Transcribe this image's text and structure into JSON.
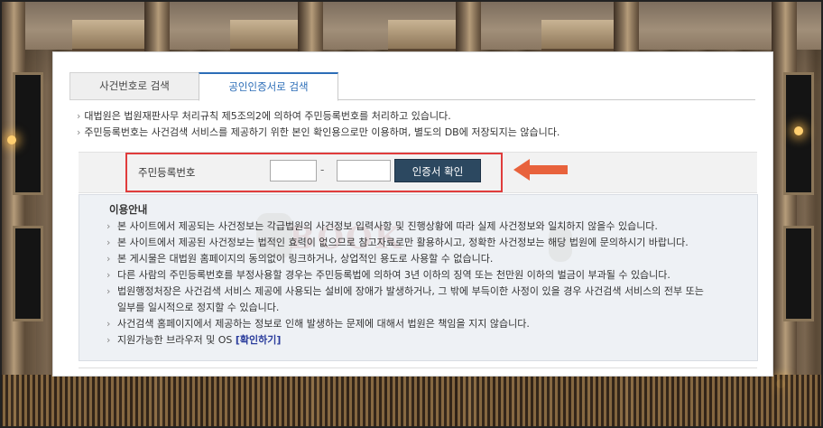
{
  "tabs": {
    "case_search": "사건번호로 검색",
    "cert_search": "공인인증서로 검색"
  },
  "notices": [
    "대법원은 법원재판사무 처리규칙 제5조의2에 의하여 주민등록번호를 처리하고 있습니다.",
    "주민등록번호는 사건검색 서비스를 제공하기 위한 본인 확인용으로만 이용하며, 별도의 DB에 저장되지는 않습니다."
  ],
  "id_form": {
    "label": "주민등록번호",
    "first_value": "",
    "second_value": "",
    "separator": "-",
    "confirm_button": "인증서 확인"
  },
  "guide": {
    "title": "이용안내",
    "watermark": "BOOK",
    "items": [
      "본 사이트에서 제공되는 사건정보는 각급법원의 사건정보 입력사항 및 진행상황에 따라 실제 사건정보와 일치하지 않을수 있습니다.",
      "본 사이트에서 제공된 사건정보는 법적인 효력이 없으므로 참고자료로만 활용하시고, 정확한 사건정보는 해당 법원에 문의하시기 바랍니다.",
      "본 게시물은 대법원 홈페이지의 동의없이 링크하거나, 상업적인 용도로 사용할 수 없습니다.",
      "다른 사람의 주민등록번호를 부정사용할 경우는 주민등록법에 의하여 3년 이하의 징역 또는 천만원 이하의 벌금이 부과될 수 있습니다.",
      "법원행정처장은 사건검색 서비스 제공에 사용되는 설비에 장애가 발생하거나, 그 밖에 부득이한 사정이 있을 경우 사건검색 서비스의 전부 또는",
      "사건검색 홈페이지에서 제공하는 정보로 인해 발생하는 문제에 대해서 법원은 책임을 지지 않습니다.",
      "지원가능한 브라우저 및 OS"
    ],
    "item5_continued": "일부를 일시적으로 정지할 수 있습니다.",
    "check_link": "[확인하기]"
  },
  "colors": {
    "accent_tab": "#2c6db7",
    "button_bg": "#2c4860",
    "highlight_box": "#e03c3c",
    "arrow": "#e8623c",
    "link": "#2a3c9c"
  }
}
